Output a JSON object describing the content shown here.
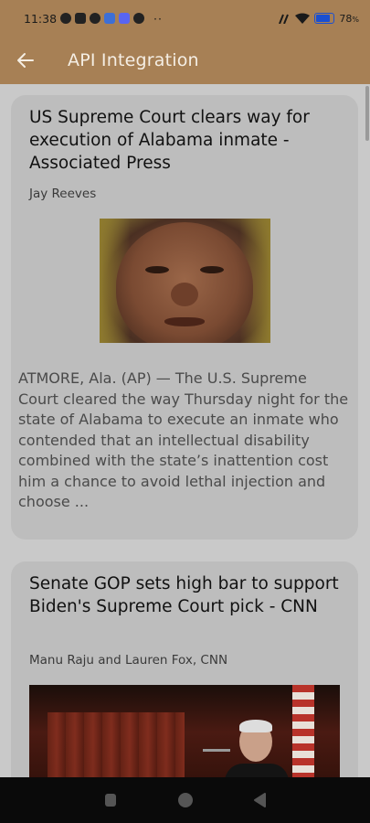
{
  "status_bar": {
    "time": "11:38",
    "battery": "78",
    "battery_unit": "%",
    "battery_level": 0.78
  },
  "app_bar": {
    "title": "API Integration",
    "back_icon": "arrow-left-icon"
  },
  "articles": [
    {
      "title": " US Supreme Court clears way for execution of Alabama inmate - Associated Press",
      "author": "Jay Reeves",
      "description": "ATMORE, Ala. (AP) — The U.S. Supreme Court cleared the way Thursday night for the state of Alabama to execute an inmate who contended that an intellectual disability combined with the state’s inattention cost him a chance to avoid lethal injection and choose ..."
    },
    {
      "title": " Senate GOP sets high bar to support Biden's Supreme Court pick - CNN",
      "author": "Manu Raju and Lauren Fox, CNN"
    }
  ],
  "nav_bar": {
    "icons": [
      "recents-square-icon",
      "home-circle-icon",
      "back-triangle-icon"
    ]
  },
  "colors": {
    "app_bar": "#a78055",
    "background": "#c9c9c9",
    "card": "#bdbdbd"
  }
}
